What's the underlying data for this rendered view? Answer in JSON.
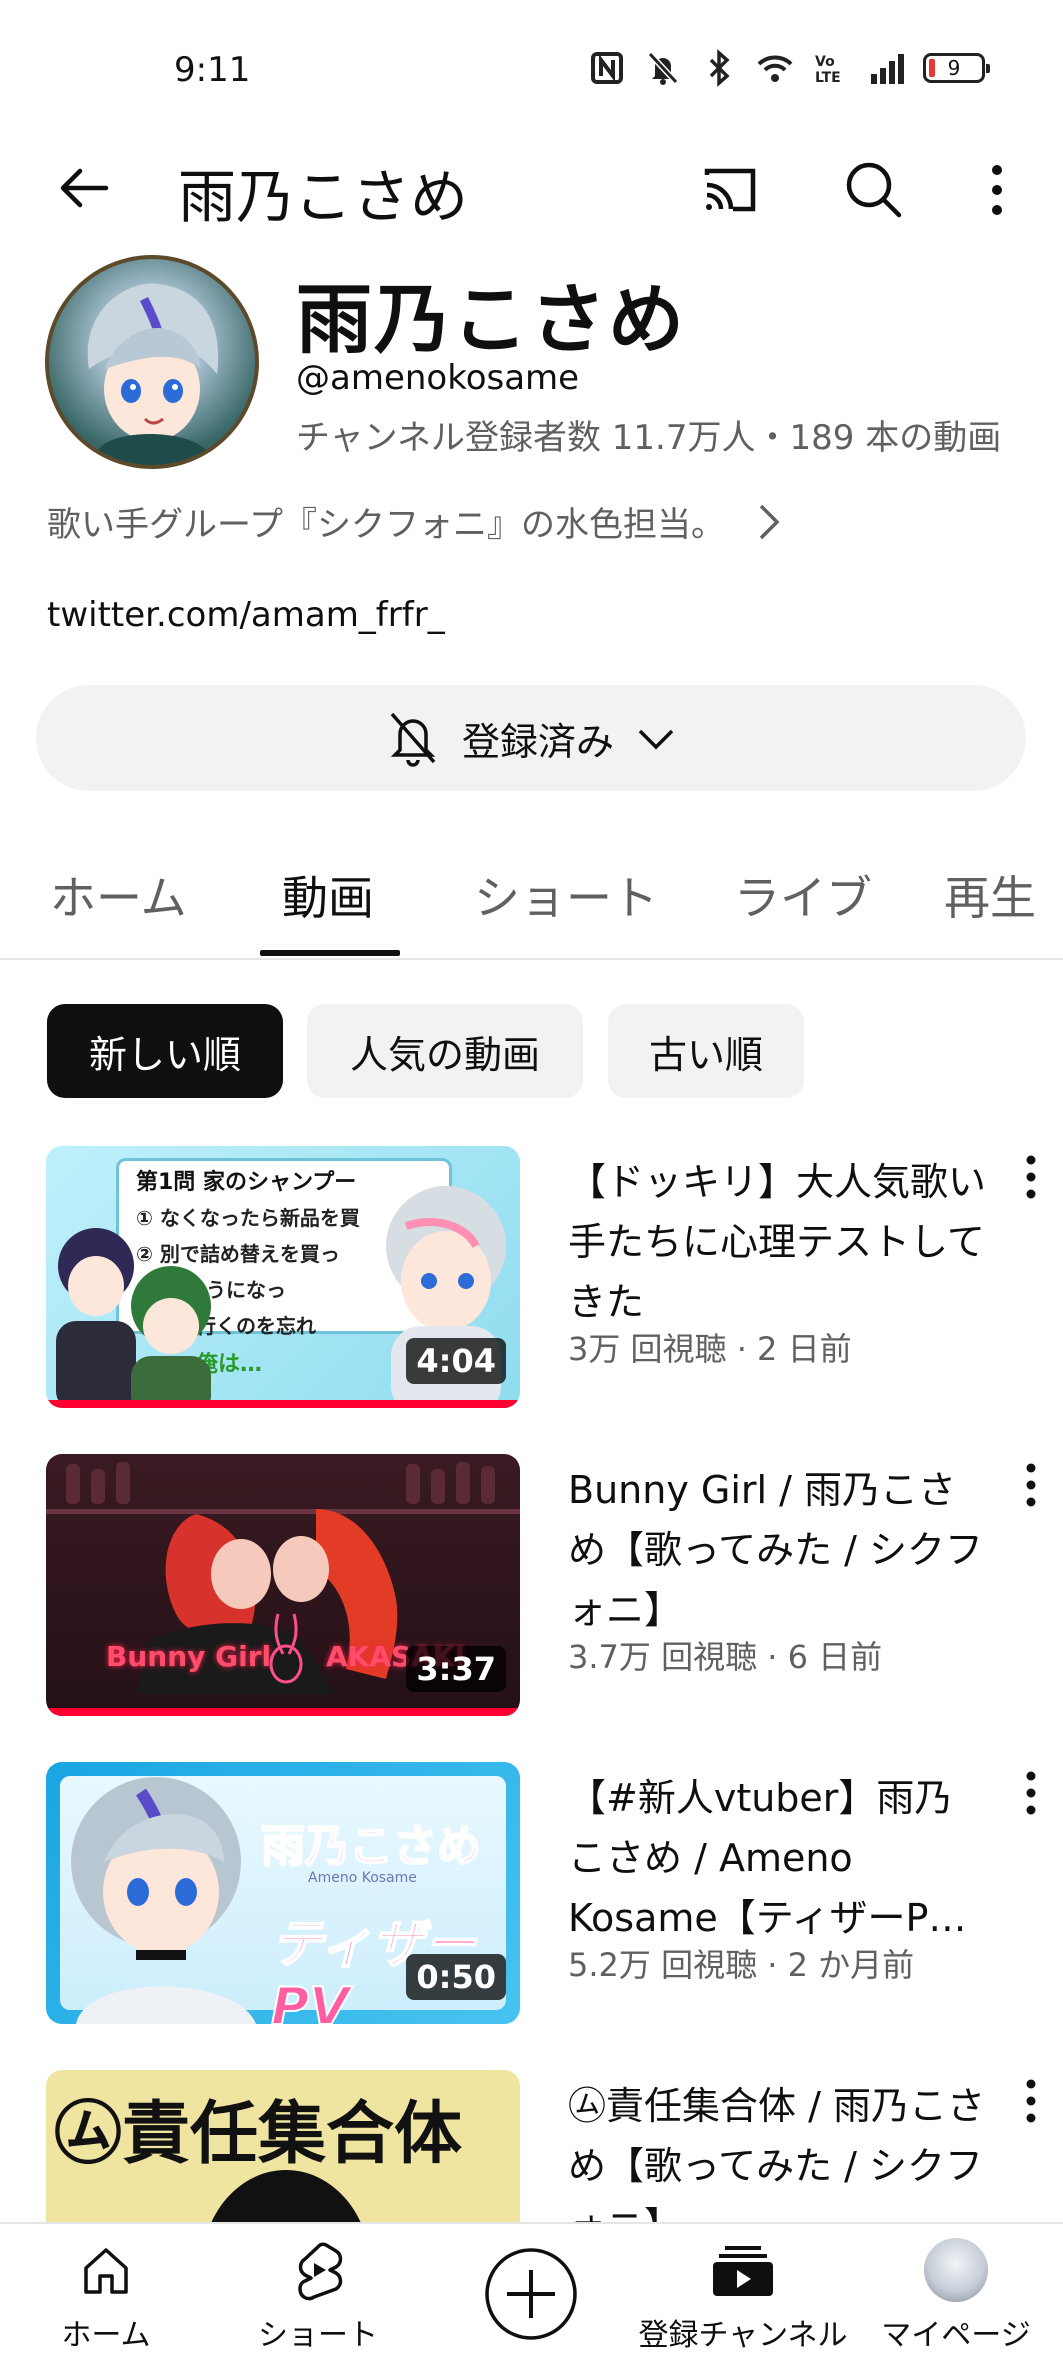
{
  "status_bar": {
    "time": "9:11",
    "battery": "9"
  },
  "top_bar": {
    "title": "雨乃こさめ",
    "icons": [
      "back-arrow-icon",
      "cast-icon",
      "search-icon",
      "more-vert-icon"
    ]
  },
  "channel": {
    "name": "雨乃こさめ",
    "handle": "@amenokosame",
    "stats": "チャンネル登録者数 11.7万人・189 本の動画",
    "description": "歌い手グループ『シクフォニ』の水色担当。",
    "link": "twitter.com/amam_frfr_"
  },
  "subscribe": {
    "label": "登録済み"
  },
  "tabs": [
    "ホーム",
    "動画",
    "ショート",
    "ライブ",
    "再生"
  ],
  "active_tab": "動画",
  "chips": [
    "新しい順",
    "人気の動画",
    "古い順"
  ],
  "active_chip": "新しい順",
  "videos": [
    {
      "title": "【ドッキリ】大人気歌い手たちに心理テストしてきた",
      "meta": "3万 回視聴 · 2 日前",
      "duration": "4:04",
      "thumb_text": "第1問 家のシャンプー",
      "thumb_lines": [
        "① なくなったら新品を買",
        "② 別で詰め替えを買っ",
        "なりそうになっ",
        "に行くのを忘れ",
        "俺は…"
      ]
    },
    {
      "title": "Bunny Girl / 雨乃こさめ【歌ってみた / シクフォニ】",
      "meta": "3.7万 回視聴 · 6 日前",
      "duration": "3:37",
      "thumb_left": "Bunny Girl",
      "thumb_right": "AKASAKI"
    },
    {
      "title": "【#新人vtuber】雨乃こさめ / Ameno Kosame【ティザーP…",
      "meta": "5.2万 回視聴 · 2 か月前",
      "duration": "0:50",
      "thumb_text": "雨乃こさめ",
      "thumb_sub": "Ameno Kosame",
      "thumb_big": "ティザーPV"
    },
    {
      "title": "㋰責任集合体 / 雨乃こさめ【歌ってみた / シクフォニ】",
      "thumb_text": "㋰責任集合体"
    }
  ],
  "bottom_nav": [
    {
      "label": "ホーム",
      "icon": "home-icon"
    },
    {
      "label": "ショート",
      "icon": "shorts-icon"
    },
    {
      "label": "",
      "icon": "create-plus-icon"
    },
    {
      "label": "登録チャンネル",
      "icon": "subscriptions-icon"
    },
    {
      "label": "マイページ",
      "icon": "avatar-icon"
    }
  ]
}
